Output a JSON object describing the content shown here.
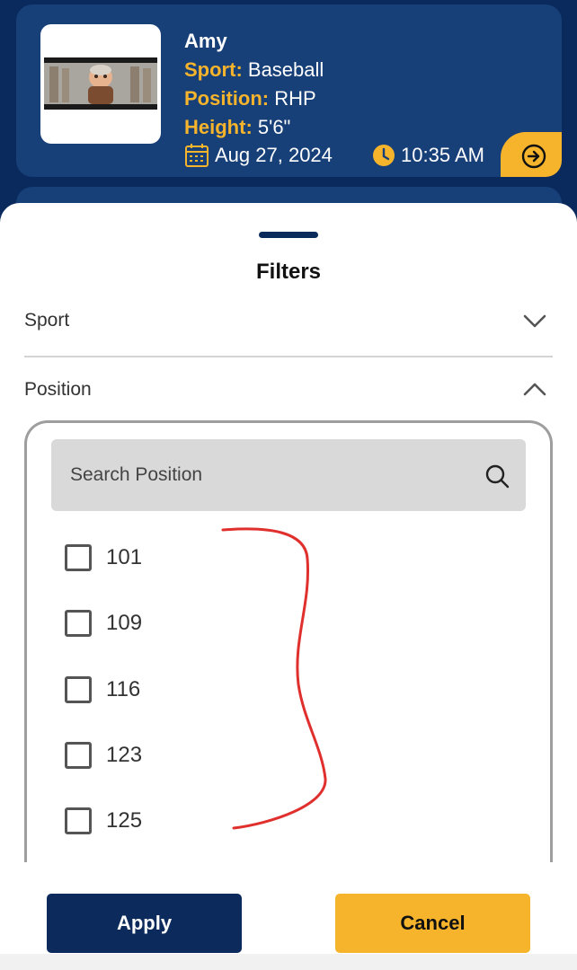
{
  "athlete": {
    "name": "Amy",
    "sport_key": "Sport:",
    "sport_value": "Baseball",
    "position_key": "Position:",
    "position_value": "RHP",
    "height_key": "Height:",
    "height_value": "5'6\"",
    "date": "Aug 27, 2024",
    "time": "10:35 AM",
    "icons": [
      "calendar-icon",
      "clock-icon",
      "arrow-right-circle-icon"
    ]
  },
  "filters": {
    "title": "Filters",
    "sections": [
      {
        "label": "Sport",
        "expanded": false,
        "icon": "chevron-down-icon"
      },
      {
        "label": "Position",
        "expanded": true,
        "icon": "chevron-up-icon"
      }
    ],
    "search_placeholder": "Search Position",
    "search_icon": "search-icon",
    "options": [
      {
        "label": "101",
        "checked": false
      },
      {
        "label": "109",
        "checked": false
      },
      {
        "label": "116",
        "checked": false
      },
      {
        "label": "123",
        "checked": false
      },
      {
        "label": "125",
        "checked": false
      }
    ]
  },
  "buttons": {
    "apply": "Apply",
    "cancel": "Cancel"
  },
  "colors": {
    "navy": "#0b2a5c",
    "card": "#173f78",
    "accent": "#f6b42c",
    "annotation": "#e0302e"
  }
}
